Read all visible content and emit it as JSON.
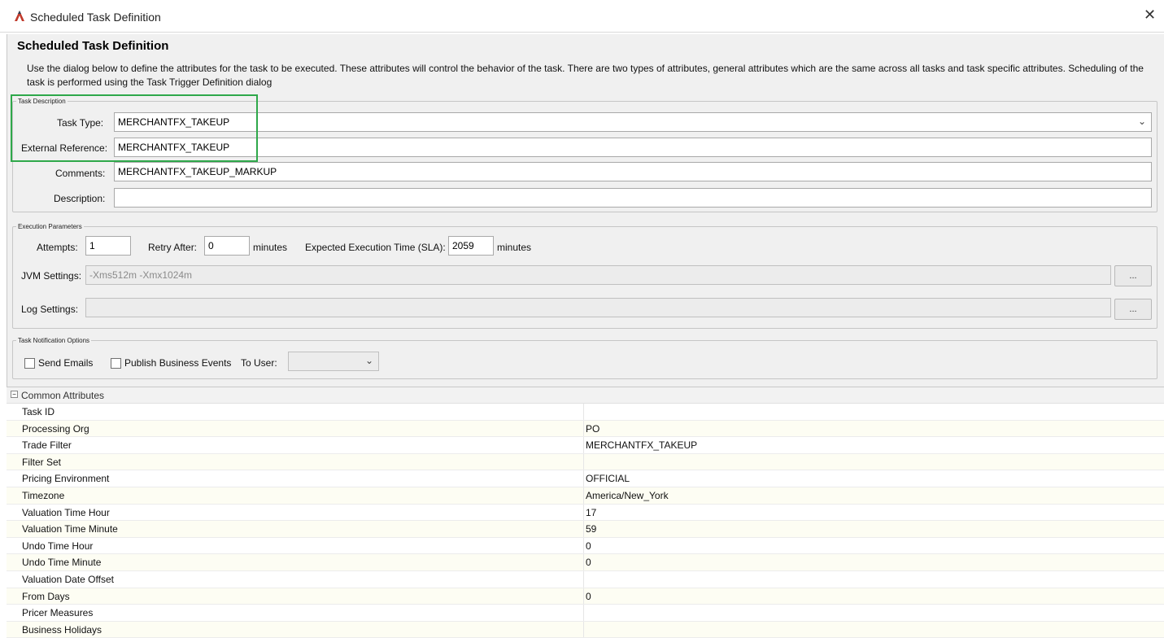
{
  "window": {
    "title": "Scheduled Task Definition",
    "close_glyph": "✕"
  },
  "header": {
    "title": "Scheduled Task Definition",
    "description": "Use the dialog below to define the attributes for the task to be executed.  These attributes will control the behavior of the task.  There are two types of attributes, general attributes which are the same across all tasks and task specific attributes.  Scheduling of the task is performed using the Task Trigger Definition dialog"
  },
  "task_description": {
    "legend": "Task Description",
    "task_type_label": "Task Type:",
    "task_type_value": "MERCHANTFX_TAKEUP",
    "external_ref_label": "External Reference:",
    "external_ref_value": "MERCHANTFX_TAKEUP",
    "comments_label": "Comments:",
    "comments_value": "MERCHANTFX_TAKEUP_MARKUP",
    "description_label": "Description:",
    "description_value": ""
  },
  "execution": {
    "legend": "Execution Parameters",
    "attempts_label": "Attempts:",
    "attempts_value": "1",
    "retry_label": "Retry After:",
    "retry_value": "0",
    "minutes_label": "minutes",
    "sla_label": "Expected Execution Time (SLA):",
    "sla_value": "2059",
    "sla_minutes_label": "minutes",
    "jvm_label": "JVM Settings:",
    "jvm_value": "-Xms512m -Xmx1024m",
    "log_label": "Log Settings:",
    "log_value": "",
    "ellipsis": "..."
  },
  "notification": {
    "legend": "Task Notification Options",
    "send_emails_label": "Send Emails",
    "publish_events_label": "Publish Business Events",
    "to_user_label": "To User:",
    "to_user_value": ""
  },
  "common_attributes": {
    "title": "Common Attributes",
    "toggle": "−",
    "rows": [
      {
        "name": "Task ID",
        "value": ""
      },
      {
        "name": "Processing Org",
        "value": "PO"
      },
      {
        "name": "Trade Filter",
        "value": "MERCHANTFX_TAKEUP"
      },
      {
        "name": "Filter Set",
        "value": ""
      },
      {
        "name": "Pricing Environment",
        "value": "OFFICIAL"
      },
      {
        "name": "Timezone",
        "value": "America/New_York"
      },
      {
        "name": "Valuation Time Hour",
        "value": "17"
      },
      {
        "name": "Valuation Time Minute",
        "value": "59"
      },
      {
        "name": "Undo Time Hour",
        "value": "0"
      },
      {
        "name": "Undo Time Minute",
        "value": "0"
      },
      {
        "name": "Valuation Date Offset",
        "value": ""
      },
      {
        "name": "From Days",
        "value": "0"
      },
      {
        "name": "Pricer Measures",
        "value": ""
      },
      {
        "name": "Business Holidays",
        "value": ""
      }
    ]
  },
  "colors": {
    "highlight": "#2ea84a",
    "dialog_bg": "#f0f0f0"
  }
}
